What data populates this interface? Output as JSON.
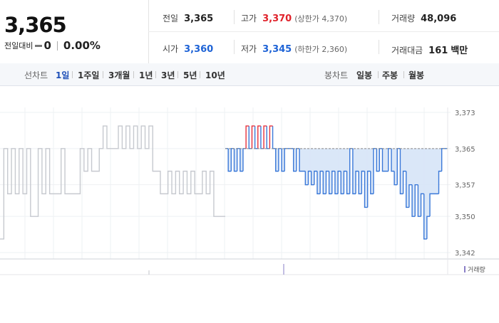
{
  "summary": {
    "price": "3,365",
    "change_label": "전일대비",
    "change_value": "0",
    "change_pct": "0.00%"
  },
  "stats": {
    "prev_close_label": "전일",
    "prev_close": "3,365",
    "high_label": "고가",
    "high": "3,370",
    "upper_limit_note": "(상한가 4,370)",
    "volume_label": "거래량",
    "volume": "48,096",
    "open_label": "시가",
    "open": "3,360",
    "low_label": "저가",
    "low": "3,345",
    "lower_limit_note": "(하한가 2,360)",
    "amount_label": "거래대금",
    "amount": "161",
    "amount_unit": "백만"
  },
  "period_bar": {
    "line_label": "선차트",
    "line_periods": [
      "1일",
      "1주일",
      "3개월",
      "1년",
      "3년",
      "5년",
      "10년"
    ],
    "active_line": "1일",
    "candle_label": "봉차트",
    "candle_periods": [
      "일봉",
      "주봉",
      "월봉"
    ]
  },
  "chart_data": {
    "type": "line",
    "title": "",
    "xlabel": "",
    "ylabel": "",
    "y_tick_labels": [
      "3,373",
      "3,365",
      "3,357",
      "3,350",
      "3,342"
    ],
    "y_ticks": [
      3373,
      3365,
      3357,
      3350,
      3342
    ],
    "ylim": [
      3340,
      3375
    ],
    "reference_price": 3365,
    "legend": [
      "거래량"
    ],
    "colors": {
      "prev_session": "#c6c9cf",
      "above_ref": "#e8323c",
      "below_ref": "#3a78d8",
      "fill_below": "#d6e4f7",
      "ref_line": "#888888"
    },
    "prev_session": {
      "name": "",
      "values": [
        3345,
        3365,
        3355,
        3365,
        3355,
        3365,
        3355,
        3365,
        3350,
        3350,
        3365,
        3355,
        3365,
        3355,
        3355,
        3355,
        3365,
        3355,
        3355,
        3355,
        3355,
        3365,
        3360,
        3365,
        3360,
        3360,
        3365,
        3370,
        3365,
        3365,
        3365,
        3370,
        3365,
        3370,
        3365,
        3370,
        3365,
        3370,
        3365,
        3370,
        3360,
        3360,
        3355,
        3355,
        3360,
        3355,
        3360,
        3355,
        3360,
        3355,
        3360,
        3355,
        3355,
        3360,
        3355,
        3360,
        3350,
        3350,
        3350
      ]
    },
    "today_session": {
      "name": "",
      "values": [
        3365,
        3360,
        3365,
        3360,
        3365,
        3360,
        3365,
        3370,
        3365,
        3370,
        3365,
        3370,
        3365,
        3370,
        3365,
        3370,
        3365,
        3360,
        3365,
        3360,
        3365,
        3365,
        3365,
        3360,
        3365,
        3360,
        3360,
        3357,
        3360,
        3357,
        3360,
        3355,
        3360,
        3355,
        3360,
        3355,
        3360,
        3355,
        3360,
        3355,
        3360,
        3355,
        3365,
        3355,
        3360,
        3355,
        3360,
        3352,
        3360,
        3355,
        3365,
        3360,
        3365,
        3360,
        3360,
        3365,
        3360,
        3357,
        3365,
        3355,
        3360,
        3352,
        3357,
        3350,
        3357,
        3350,
        3355,
        3345,
        3350,
        3355,
        3355,
        3355,
        3360,
        3365,
        3365
      ]
    }
  }
}
